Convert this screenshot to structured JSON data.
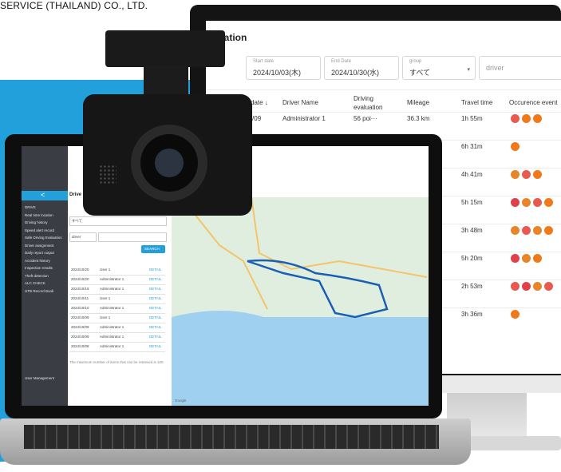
{
  "company": "SERVICE (THAILAND) CO., LTD.",
  "monitor": {
    "title": "luation",
    "start_date_label": "Start date",
    "start_date": "2024/10/03(木)",
    "end_date_label": "End Date",
    "end_date": "2024/10/30(水)",
    "group_label": "group",
    "group": "すべて",
    "driver_placeholder": "driver",
    "headers": [
      "date ↓",
      "Driver Name",
      "Driving evaluation",
      "Mileage",
      "Travel time",
      "Occurence event"
    ],
    "rows": [
      {
        "date": "24/10/09",
        "driver": "Administrator 1",
        "eval": "56 poi···",
        "mileage": "36.3 km",
        "time": "1h 55m",
        "events": [
          "#e85a4f",
          "#f07a1a",
          "#f07a1a"
        ]
      },
      {
        "date": "",
        "driver": "",
        "eval": "",
        "mileage": "",
        "time": "6h 31m",
        "events": [
          "#f07a1a"
        ]
      },
      {
        "date": "",
        "driver": "",
        "eval": "",
        "mileage": "",
        "time": "4h 41m",
        "events": [
          "#e8842a",
          "#e85a4f",
          "#f07a1a"
        ]
      },
      {
        "date": "",
        "driver": "",
        "eval": "",
        "mileage": "",
        "time": "5h 15m",
        "events": [
          "#e0404a",
          "#e8842a",
          "#e85a4f",
          "#f07a1a"
        ]
      },
      {
        "date": "",
        "driver": "",
        "eval": "",
        "mileage": "",
        "time": "3h 48m",
        "events": [
          "#e8842a",
          "#e85a4f",
          "#e8842a",
          "#f07a1a"
        ]
      },
      {
        "date": "",
        "driver": "",
        "eval": "",
        "mileage": "",
        "time": "5h 20m",
        "events": [
          "#e0404a",
          "#e8842a",
          "#f07a1a"
        ]
      },
      {
        "date": "",
        "driver": "",
        "eval": "",
        "mileage": "",
        "time": "2h 53m",
        "events": [
          "#e85a4f",
          "#e0404a",
          "#e8842a",
          "#e85a4f"
        ]
      },
      {
        "date": "",
        "driver": "",
        "eval": "",
        "mileage": "",
        "time": "3h 36m",
        "events": [
          "#f07a1a"
        ]
      }
    ]
  },
  "laptop": {
    "back_glyph": "<",
    "sidebar_items": [
      "DRIVE",
      "Real time location",
      "Driving history",
      "Speed alert record",
      "Safe Driving Evaluation",
      "Driver assignment",
      "Daily report output",
      "Accident history",
      "Inspection results",
      "Theft detection",
      "ALC CHECK",
      "HTB Record Book",
      "User Management"
    ],
    "panel_title": "Drive",
    "group_value": "すべて",
    "driver_value": "driver",
    "search_button": "SEARCH",
    "list_rows": [
      {
        "date": "2024/10/20",
        "name": "User 1",
        "action": "DETAIL"
      },
      {
        "date": "2024/10/20",
        "name": "Administrator 1",
        "action": "DETAIL"
      },
      {
        "date": "2024/10/18",
        "name": "Administrator 1",
        "action": "DETAIL"
      },
      {
        "date": "2024/10/11",
        "name": "User 1",
        "action": "DETAIL"
      },
      {
        "date": "2024/10/10",
        "name": "Administrator 1",
        "action": "DETAIL"
      },
      {
        "date": "2024/10/09",
        "name": "User 1",
        "action": "DETAIL"
      },
      {
        "date": "2024/10/09",
        "name": "Administrator 1",
        "action": "DETAIL"
      },
      {
        "date": "2024/10/09",
        "name": "Administrator 1",
        "action": "DETAIL"
      },
      {
        "date": "2024/10/08",
        "name": "Administrator 1",
        "action": "DETAIL"
      }
    ],
    "footnote": "The maximum number of items that can be retrieved is 100.",
    "map_attrib": "Google"
  },
  "colors": {
    "accent_blue": "#22a0dc",
    "route": "#1a5fb4",
    "sidebar": "#3a3d44"
  }
}
